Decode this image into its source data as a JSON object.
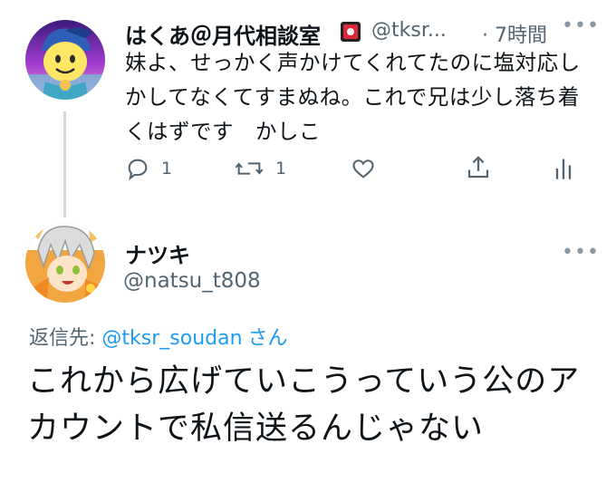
{
  "tweet1": {
    "display_name": "はくあ＠月代相談室",
    "name_emoji_icon": "red-envelope-card-icon",
    "handle": "@tksr...",
    "time": "· 7時間",
    "body": "妹よ、せっかく声かけてくれてたのに塩対応しかしてなくてすまぬね。これで兄は少し落ち着くはずです　かしこ",
    "actions": {
      "reply_count": "1",
      "retweet_count": "1"
    }
  },
  "tweet2": {
    "display_name": "ナツキ",
    "handle": "@natsu_t808",
    "reply_to_prefix": "返信先: ",
    "reply_to_mention": "@tksr_soudan",
    "reply_to_suffix": "さん",
    "body": "これから広げていこうっていう公のアカウントで私信送るんじゃない"
  },
  "colors": {
    "text": "#0f1419",
    "muted": "#536471",
    "link": "#1d9bf0",
    "thread_line": "#cfd9de"
  }
}
